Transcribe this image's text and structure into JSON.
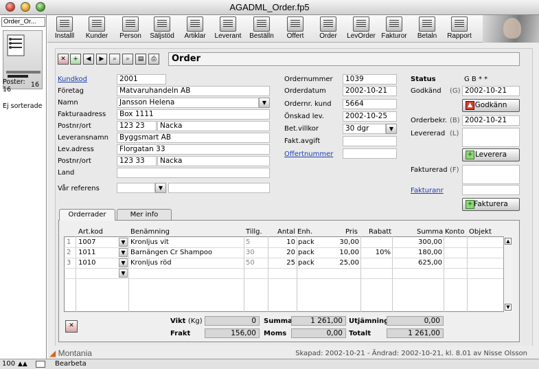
{
  "window": {
    "title": "AGADML_Order.fp5"
  },
  "left_panel": {
    "layout": "Order_Or...",
    "record_number": "16",
    "records_label": "Poster:",
    "records_count": "16",
    "sort_status": "Ej sorterade"
  },
  "toolbar": [
    {
      "label": "Installl",
      "icon": "install-icon"
    },
    {
      "label": "Kunder",
      "icon": "customers-icon"
    },
    {
      "label": "Person",
      "icon": "person-icon"
    },
    {
      "label": "Säljstöd",
      "icon": "sales-icon"
    },
    {
      "label": "Artiklar",
      "icon": "articles-icon"
    },
    {
      "label": "Leverant",
      "icon": "supplier-icon"
    },
    {
      "label": "Beställn",
      "icon": "purchase-icon"
    },
    {
      "label": "Offert",
      "icon": "quote-icon"
    },
    {
      "label": "Order",
      "icon": "order-icon"
    },
    {
      "label": "LevOrder",
      "icon": "delivery-order-icon"
    },
    {
      "label": "Fakturor",
      "icon": "invoices-icon"
    },
    {
      "label": "Betaln",
      "icon": "payments-icon"
    },
    {
      "label": "Rapport",
      "icon": "printer-icon"
    }
  ],
  "form": {
    "title": "Order"
  },
  "customer": {
    "kundkod_label": "Kundkod",
    "kundkod": "2001",
    "foretag_label": "Företag",
    "foretag": "Matvaruhandeln AB",
    "namn_label": "Namn",
    "namn": "Jansson Helena",
    "fakturaadress_label": "Fakturaadress",
    "fakturaadress": "Box 1111",
    "postnr_label": "Postnr/ort",
    "postnr": "123 23",
    "ort": "Nacka",
    "leveransnamn_label": "Leveransnamn",
    "leveransnamn": "Byggsmart AB",
    "levadress_label": "Lev.adress",
    "levadress": "Florgatan 33",
    "postnr2_label": "Postnr/ort",
    "postnr2": "123 33",
    "ort2": "Nacka",
    "land_label": "Land",
    "land": "",
    "var_referens_label": "Vår referens",
    "var_referens": "",
    "var_referens2": ""
  },
  "order": {
    "ordernummer_label": "Ordernummer",
    "ordernummer": "1039",
    "orderdatum_label": "Orderdatum",
    "orderdatum": "2002-10-21",
    "ordernr_kund_label": "Ordernr. kund",
    "ordernr_kund": "5664",
    "onskad_lev_label": "Önskad lev.",
    "onskad_lev": "2002-10-25",
    "betvillkor_label": "Bet.villkor",
    "betvillkor": "30 dgr",
    "faktavgift_label": "Fakt.avgift",
    "faktavgift": "",
    "offertnummer_label": "Offertnummer",
    "offertnummer": ""
  },
  "status": {
    "status_label": "Status",
    "status_value": "G B * *",
    "godkand_label": "Godkänd",
    "godkand_key": "(G)",
    "godkand": "2002-10-21",
    "godkann_button": "Godkänn",
    "orderbekr_label": "Orderbekr.",
    "orderbekr_key": "(B)",
    "orderbekr": "2002-10-21",
    "levererad_label": "Levererad",
    "levererad_key": "(L)",
    "levererad": "",
    "leverera_button": "Leverera",
    "fakturerad_label": "Fakturerad",
    "fakturerad_key": "(F)",
    "fakturerad": "",
    "fakturanr_label": "Fakturanr",
    "fakturanr": "",
    "fakturera_button": "Fakturera"
  },
  "tabs": [
    {
      "label": "Orderrader"
    },
    {
      "label": "Mer info"
    }
  ],
  "portal": {
    "headers": {
      "artkod": "Art.kod",
      "benamning": "Benämning",
      "tillg": "Tillg.",
      "antal": "Antal",
      "enh": "Enh.",
      "pris": "Pris",
      "rabatt": "Rabatt",
      "summa": "Summa",
      "konto": "Konto",
      "objekt": "Objekt"
    },
    "rows": [
      {
        "n": "1",
        "artkod": "1007",
        "benamning": "Kronljus vit",
        "tillg": "5",
        "antal": "10",
        "enh": "pack",
        "pris": "30,00",
        "rabatt": "",
        "summa": "300,00"
      },
      {
        "n": "2",
        "artkod": "1011",
        "benamning": "Barnängen Cr Shampoo",
        "tillg": "30",
        "antal": "20",
        "enh": "pack",
        "pris": "10,00",
        "rabatt": "10%",
        "summa": "180,00"
      },
      {
        "n": "3",
        "artkod": "1010",
        "benamning": "Kronljus röd",
        "tillg": "50",
        "antal": "25",
        "enh": "pack",
        "pris": "25,00",
        "rabatt": "",
        "summa": "625,00"
      }
    ]
  },
  "totals": {
    "vikt_label": "Vikt",
    "vikt_unit": "(Kg)",
    "vikt": "0",
    "frakt_label": "Frakt",
    "frakt": "156,00",
    "summa_label": "Summa",
    "summa": "1 261,00",
    "moms_label": "Moms",
    "moms": "0,00",
    "utjamning_label": "Utjämning",
    "utjamning": "0,00",
    "totalt_label": "Totalt",
    "totalt": "1 261,00"
  },
  "footer": {
    "logo": "Montania",
    "created": "Skapad: 2002-10-21  -  Ändrad: 2002-10-21, kl. 8.01 av Nisse Olsson"
  },
  "statusbar": {
    "zoom": "100",
    "mode": "Bearbeta"
  }
}
